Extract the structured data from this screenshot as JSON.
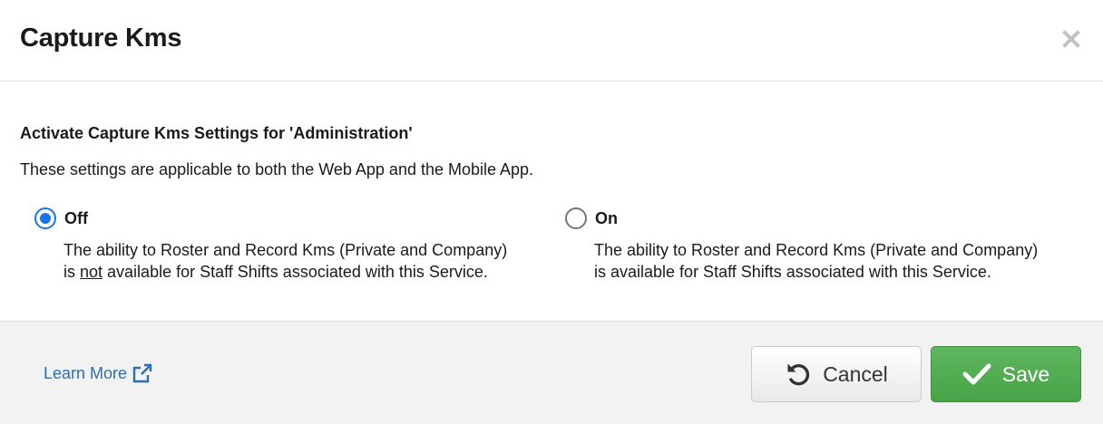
{
  "dialog": {
    "title": "Capture Kms"
  },
  "content": {
    "heading": "Activate Capture Kms Settings for 'Administration'",
    "description": "These settings are applicable to both the Web App and the Mobile App.",
    "options": [
      {
        "label": "Off",
        "selected": true,
        "description_line1": "The ability to Roster and Record Kms (Private and Company)",
        "description_line2_prefix": "is ",
        "description_line2_emphasis": "not",
        "description_line2_suffix": " available for Staff Shifts associated with this Service."
      },
      {
        "label": "On",
        "selected": false,
        "description_line1": "The ability to Roster and Record Kms (Private and Company)",
        "description_line2": "is available for Staff Shifts associated with this Service."
      }
    ]
  },
  "footer": {
    "learn_more_label": "Learn More",
    "cancel_label": "Cancel",
    "save_label": "Save"
  },
  "icons": {
    "close": "close-icon",
    "external_link": "external-link-icon",
    "undo": "undo-icon",
    "checkmark": "checkmark-icon"
  },
  "colors": {
    "accent": "#1a73e8",
    "link": "#2a6fb3",
    "save": "#4cae4c"
  }
}
